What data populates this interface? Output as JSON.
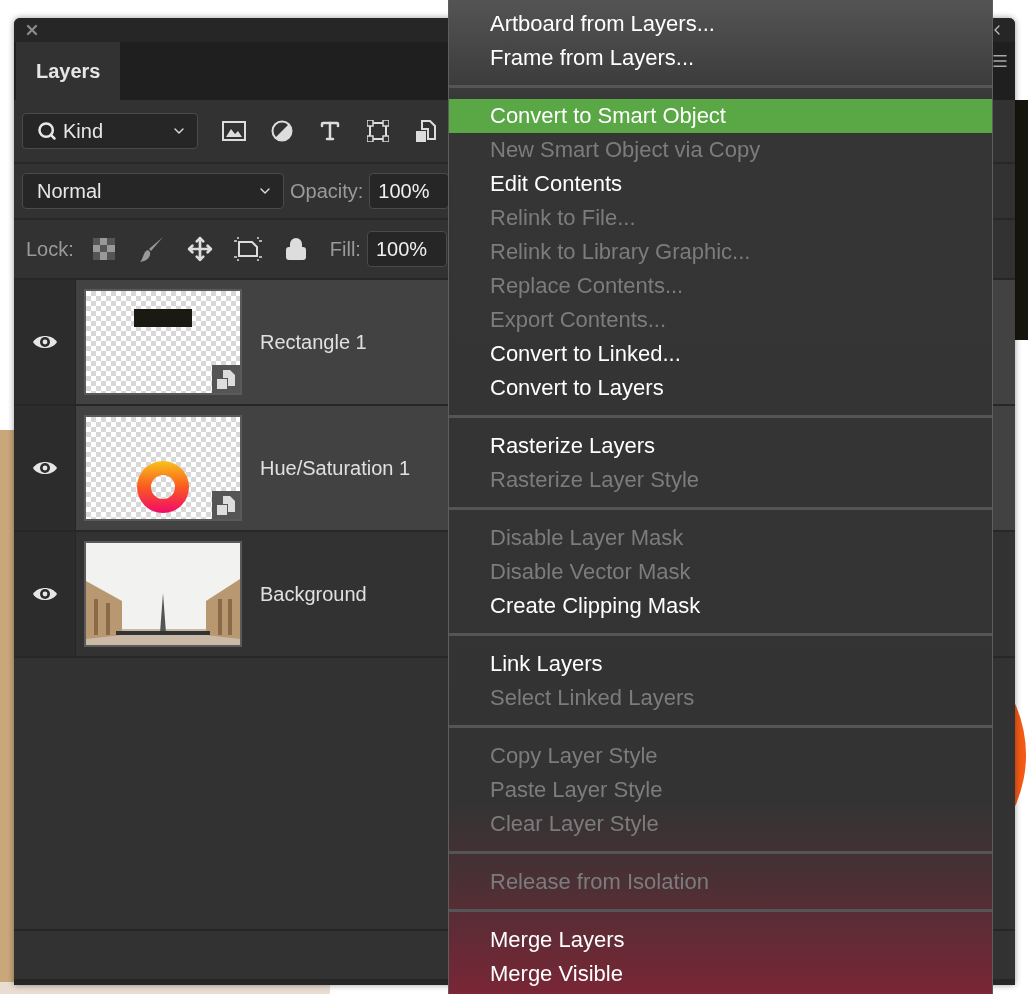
{
  "panel": {
    "tab": "Layers",
    "filter": {
      "value": "Kind"
    },
    "blend_mode": "Normal",
    "opacity": {
      "label": "Opacity:",
      "value": "100%"
    },
    "lock": {
      "label": "Lock:"
    },
    "fill": {
      "label": "Fill:",
      "value": "100%"
    },
    "layers": [
      {
        "name": "Rectangle 1",
        "visible": true,
        "selected": true,
        "kind": "shape"
      },
      {
        "name": "Hue/Saturation 1",
        "visible": true,
        "selected": true,
        "kind": "ring"
      },
      {
        "name": "Background",
        "visible": true,
        "selected": false
      }
    ]
  },
  "context_menu": {
    "groups": [
      [
        {
          "label": "Artboard from Layers...",
          "disabled": false,
          "highlighted": false
        },
        {
          "label": "Frame from Layers...",
          "disabled": false,
          "highlighted": false
        }
      ],
      [
        {
          "label": "Convert to Smart Object",
          "disabled": false,
          "highlighted": true
        },
        {
          "label": "New Smart Object via Copy",
          "disabled": true,
          "highlighted": false
        },
        {
          "label": "Edit Contents",
          "disabled": false,
          "highlighted": false
        },
        {
          "label": "Relink to File...",
          "disabled": true,
          "highlighted": false
        },
        {
          "label": "Relink to Library Graphic...",
          "disabled": true,
          "highlighted": false
        },
        {
          "label": "Replace Contents...",
          "disabled": true,
          "highlighted": false
        },
        {
          "label": "Export Contents...",
          "disabled": true,
          "highlighted": false
        },
        {
          "label": "Convert to Linked...",
          "disabled": false,
          "highlighted": false
        },
        {
          "label": "Convert to Layers",
          "disabled": false,
          "highlighted": false
        }
      ],
      [
        {
          "label": "Rasterize Layers",
          "disabled": false,
          "highlighted": false
        },
        {
          "label": "Rasterize Layer Style",
          "disabled": true,
          "highlighted": false
        }
      ],
      [
        {
          "label": "Disable Layer Mask",
          "disabled": true,
          "highlighted": false
        },
        {
          "label": "Disable Vector Mask",
          "disabled": true,
          "highlighted": false
        },
        {
          "label": "Create Clipping Mask",
          "disabled": false,
          "highlighted": false
        }
      ],
      [
        {
          "label": "Link Layers",
          "disabled": false,
          "highlighted": false
        },
        {
          "label": "Select Linked Layers",
          "disabled": true,
          "highlighted": false
        }
      ],
      [
        {
          "label": "Copy Layer Style",
          "disabled": true,
          "highlighted": false
        },
        {
          "label": "Paste Layer Style",
          "disabled": true,
          "highlighted": false
        },
        {
          "label": "Clear Layer Style",
          "disabled": true,
          "highlighted": false
        }
      ],
      [
        {
          "label": "Release from Isolation",
          "disabled": true,
          "highlighted": false
        }
      ],
      [
        {
          "label": "Merge Layers",
          "disabled": false,
          "highlighted": false
        },
        {
          "label": "Merge Visible",
          "disabled": false,
          "highlighted": false
        }
      ]
    ]
  }
}
